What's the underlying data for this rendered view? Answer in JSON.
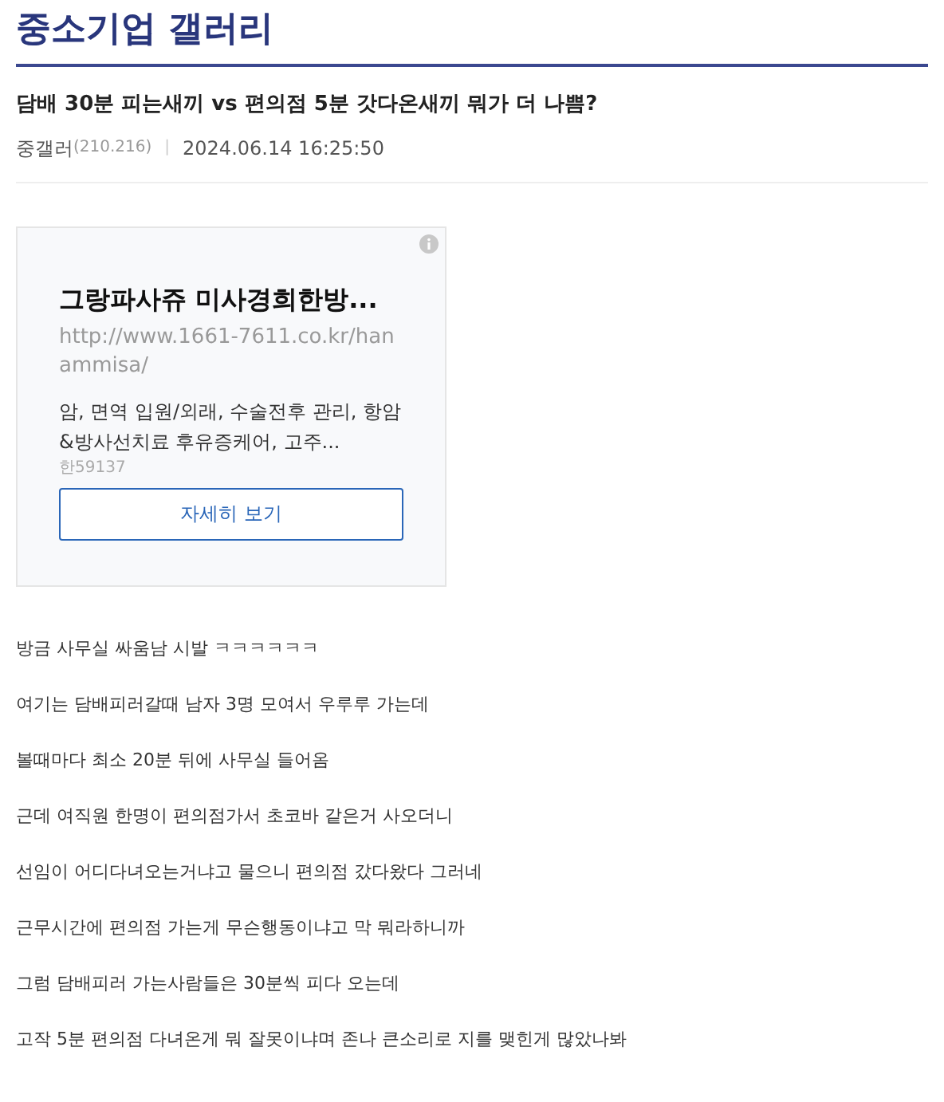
{
  "gallery_title": "중소기업 갤러리",
  "post": {
    "title": "담배 30분 피는새끼 vs 편의점 5분 갓다온새끼 뭐가 더 나쁨?",
    "author": "중갤러",
    "ip": "(210.216)",
    "separator": "|",
    "date": "2024.06.14 16:25:50"
  },
  "ad": {
    "headline": "그랑파사쥬 미사경희한방...",
    "url": "http://www.1661-7611.co.kr/hanammisa/",
    "description": "암, 면역 입원/외래, 수술전후 관리, 항암&방사선치료 후유증케어, 고주...",
    "code": "한59137",
    "button": "자세히 보기"
  },
  "body": [
    "방금 사무실 싸움남 시발 ㅋㅋㅋㅋㅋㅋ",
    "여기는 담배피러갈때 남자 3명 모여서 우루루 가는데",
    "볼때마다 최소 20분 뒤에 사무실 들어옴",
    "근데 여직원 한명이 편의점가서 초코바 같은거 사오더니",
    "선임이 어디다녀오는거냐고 물으니 편의점 갔다왔다 그러네",
    "근무시간에 편의점 가는게 무슨행동이냐고 막 뭐라하니까",
    "그럼 담배피러 가는사람들은 30분씩 피다 오는데",
    "고작 5분 편의점 다녀온게 뭐 잘못이냐며 존나 큰소리로 지를 맺힌게 많았나봐"
  ]
}
